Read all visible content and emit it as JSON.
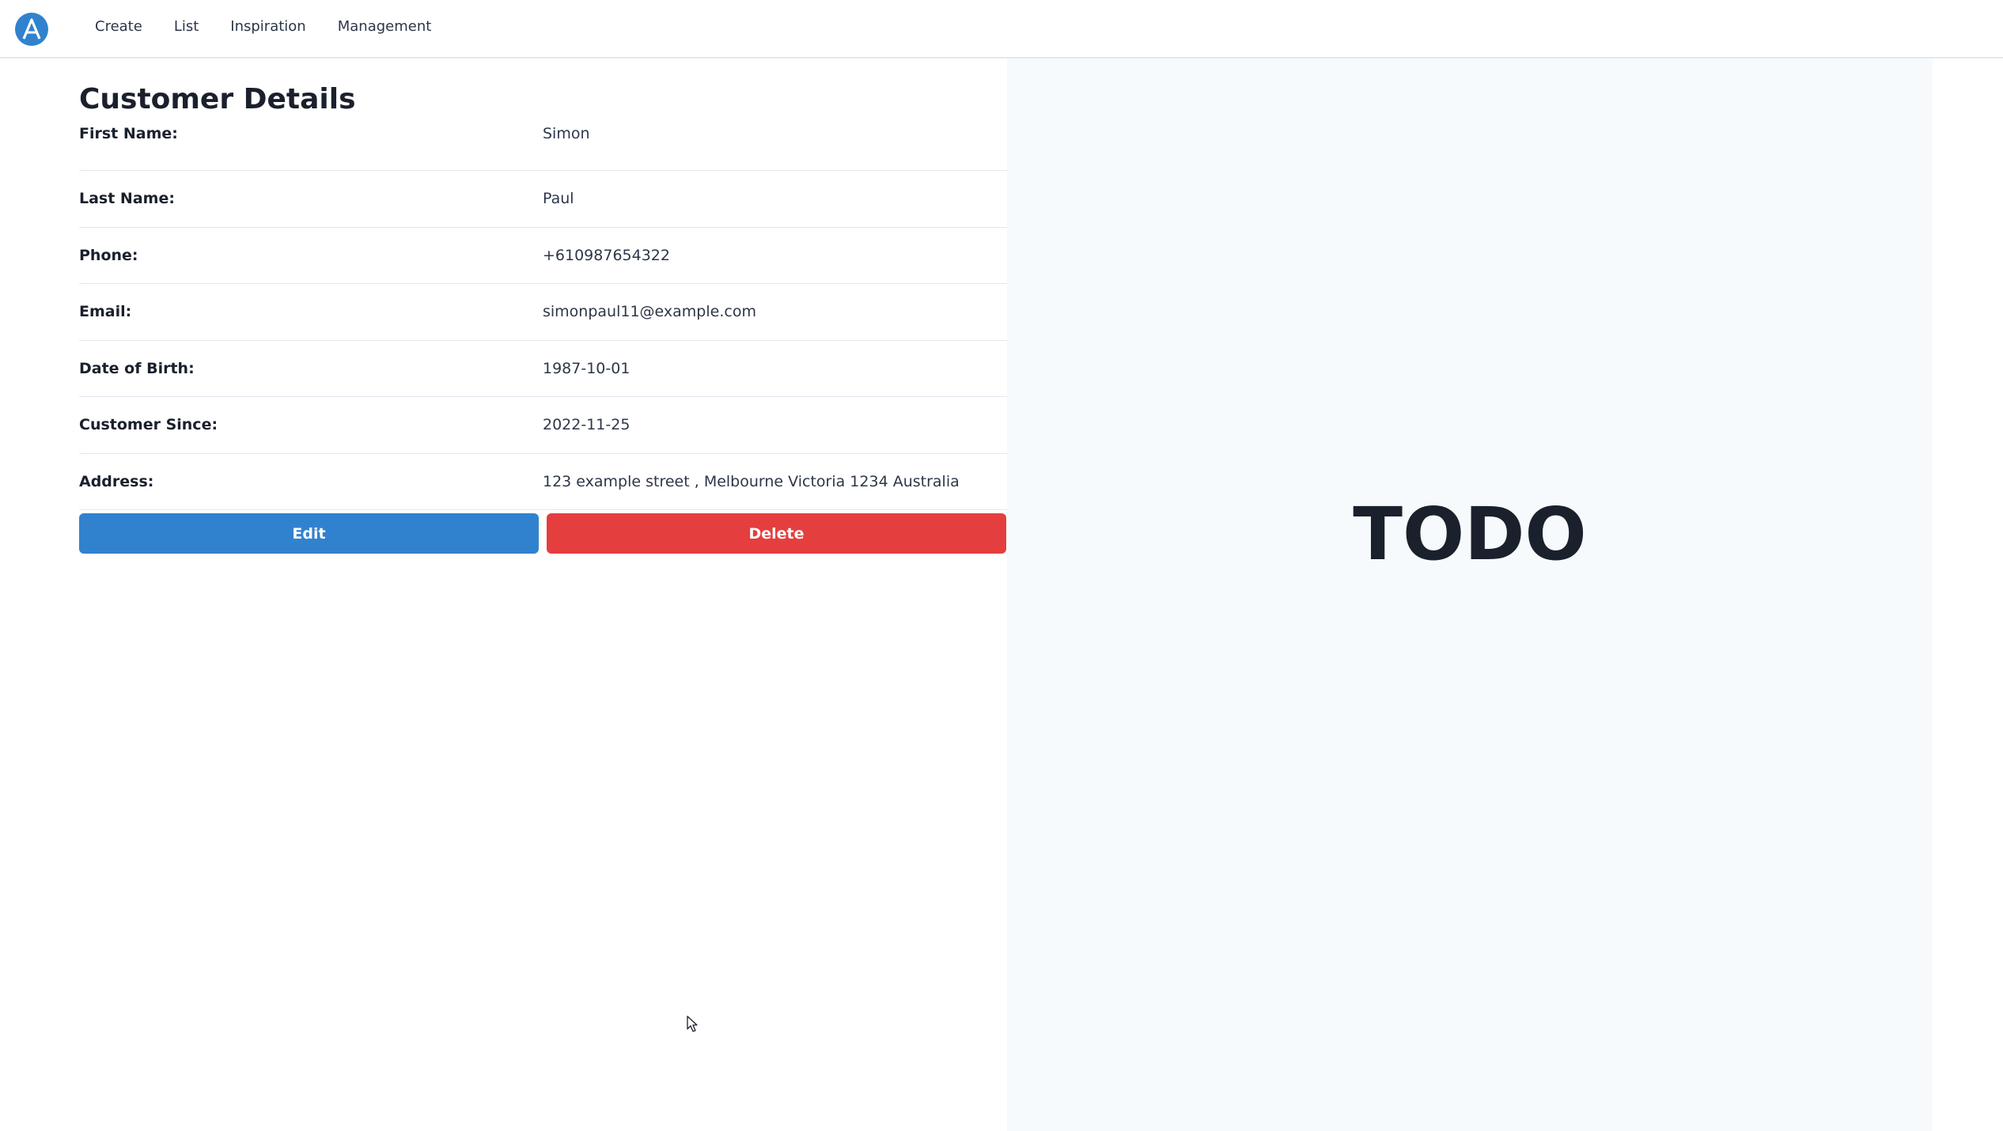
{
  "header": {
    "logo_letter": "A",
    "nav": [
      {
        "label": "Create"
      },
      {
        "label": "List"
      },
      {
        "label": "Inspiration"
      },
      {
        "label": "Management"
      }
    ]
  },
  "details": {
    "title": "Customer Details",
    "rows": [
      {
        "label": "First Name:",
        "value": "Simon"
      },
      {
        "label": "Last Name:",
        "value": "Paul"
      },
      {
        "label": "Phone:",
        "value": "+610987654322"
      },
      {
        "label": "Email:",
        "value": "simonpaul11@example.com"
      },
      {
        "label": "Date of Birth:",
        "value": "1987-10-01"
      },
      {
        "label": "Customer Since:",
        "value": "2022-11-25"
      },
      {
        "label": "Address:",
        "value": "123 example street , Melbourne Victoria 1234 Australia"
      }
    ],
    "edit_label": "Edit",
    "delete_label": "Delete"
  },
  "panel": {
    "placeholder": "TODO"
  },
  "colors": {
    "primary": "#3182ce",
    "danger": "#e53e3e",
    "panel_bg": "#f7fafc"
  },
  "icons": {
    "logo": "a-logo-icon",
    "cursor": "mouse-pointer-icon"
  }
}
